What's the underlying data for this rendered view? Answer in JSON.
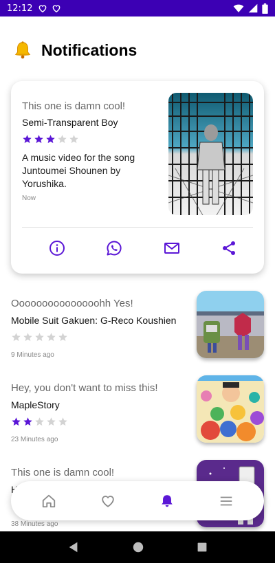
{
  "status_bar": {
    "time": "12:12"
  },
  "header": {
    "title": "Notifications"
  },
  "featured": {
    "intro": "This one is damn cool!",
    "title": "Semi-Transparent Boy",
    "rating": 3,
    "max_rating": 5,
    "description": "A music video for the song Juntoumei Shounen by Yorushika.",
    "time": "Now"
  },
  "notifications": [
    {
      "intro": "Ooooooooooooooohh Yes!",
      "title": "Mobile Suit Gakuen: G-Reco Koushien",
      "rating": 0,
      "time": "9 Minutes ago"
    },
    {
      "intro": "Hey, you don't want to miss this!",
      "title": "MapleStory",
      "rating": 2,
      "time": "23 Minutes ago"
    },
    {
      "intro": "This one is damn cool!",
      "title": "H",
      "rating": 0,
      "time": "38 Minutes ago"
    }
  ],
  "colors": {
    "accent": "#5b17d6",
    "status_bar": "#3c00b4",
    "star_empty": "#d3d3d3"
  },
  "icons": {
    "actions": [
      "info-icon",
      "whatsapp-icon",
      "mail-icon",
      "share-icon"
    ],
    "nav": [
      "home-icon",
      "heart-icon",
      "bell-icon",
      "menu-icon"
    ]
  }
}
